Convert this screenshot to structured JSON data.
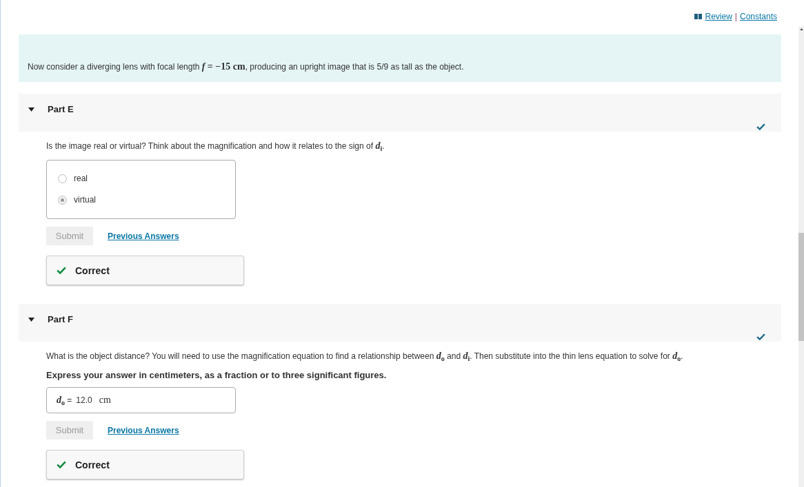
{
  "toolbar": {
    "review_link": "Review",
    "separator": "|",
    "constants_link": "Constants"
  },
  "intro": "Now consider a diverging lens with focal length *f* **= −15 cm**, producing an upright image that is 5/9 as tall as the object.",
  "parts": [
    {
      "title": "Part E",
      "expanded": true,
      "completed": true,
      "question": "Is the image real or virtual? Think about the magnification and how it relates to the sign of *d*$_{i}$.",
      "kind": "choice",
      "options": [
        {
          "label": "real",
          "selected": false
        },
        {
          "label": "virtual",
          "selected": true
        }
      ],
      "submit": {
        "label": "Submit",
        "disabled": true
      },
      "previous_answers": "Previous Answers",
      "feedback": {
        "correct": true,
        "text": "Correct"
      }
    },
    {
      "title": "Part F",
      "expanded": true,
      "completed": true,
      "question": "What is the object distance? You will need to use the magnification equation to find a relationship between *d*$_{o}$ and *d*$_{i}$. Then substitute into the thin lens equation to solve for *d*$_{o}$.",
      "instruction": "Express your answer in centimeters, as a fraction or to three significant figures.",
      "kind": "numeric",
      "answer": {
        "label": "*d*$_{o}$ =",
        "value": "12.0",
        "unit": "cm"
      },
      "submit": {
        "label": "Submit",
        "disabled": true
      },
      "previous_answers": "Previous Answers",
      "feedback": {
        "correct": true,
        "text": "Correct"
      }
    }
  ]
}
